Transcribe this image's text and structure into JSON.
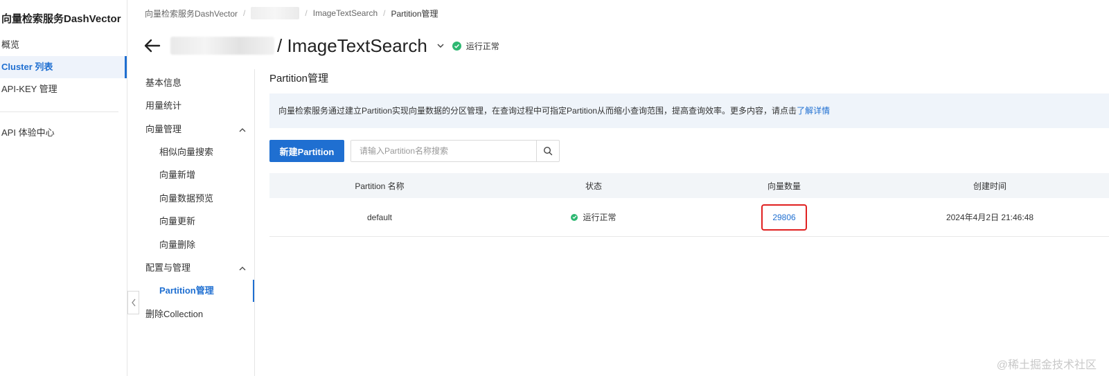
{
  "nav": {
    "title": "向量检索服务DashVector",
    "items": [
      {
        "label": "概览",
        "active": false
      },
      {
        "label": "Cluster 列表",
        "active": true
      },
      {
        "label": "API-KEY 管理",
        "active": false
      },
      {
        "label": "API 体验中心",
        "active": false
      }
    ]
  },
  "breadcrumb": {
    "root": "向量检索服务DashVector",
    "collection": "ImageTextSearch",
    "current": "Partition管理"
  },
  "header": {
    "title_suffix": "/ ImageTextSearch",
    "status": "运行正常"
  },
  "subnav": {
    "items": [
      {
        "label": "基本信息"
      },
      {
        "label": "用量统计"
      },
      {
        "label": "向量管理"
      },
      {
        "label": "相似向量搜索"
      },
      {
        "label": "向量新增"
      },
      {
        "label": "向量数据预览"
      },
      {
        "label": "向量更新"
      },
      {
        "label": "向量删除"
      },
      {
        "label": "配置与管理"
      },
      {
        "label": "Partition管理"
      },
      {
        "label": "删除Collection"
      }
    ]
  },
  "main": {
    "title": "Partition管理",
    "info_text": "向量检索服务通过建立Partition实现向量数据的分区管理，在查询过程中可指定Partition从而缩小查询范围，提高查询效率。更多内容，请点击",
    "info_link": "了解详情",
    "new_button": "新建Partition",
    "search_placeholder": "请输入Partition名称搜索",
    "table": {
      "headers": [
        "Partition 名称",
        "状态",
        "向量数量",
        "创建时间"
      ],
      "rows": [
        {
          "name": "default",
          "status": "运行正常",
          "count": "29806",
          "created": "2024年4月2日 21:46:48"
        }
      ]
    }
  },
  "watermark": "@稀土掘金技术社区",
  "colors": {
    "accent": "#1f6fd1",
    "success": "#2eb872",
    "highlight": "#e02020"
  }
}
